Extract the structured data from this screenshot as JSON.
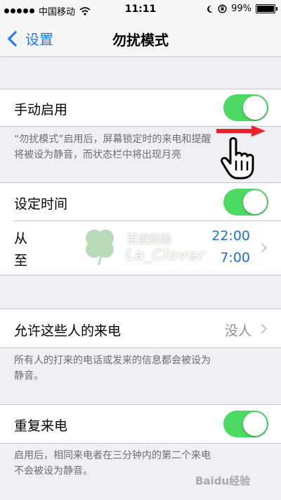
{
  "status_bar": {
    "carrier": "中国移动",
    "time": "11:11",
    "battery": "99%",
    "battery_level": 0.99
  },
  "nav": {
    "back_label": "设置",
    "title": "勿扰模式"
  },
  "manual": {
    "label": "手动启用",
    "on": true,
    "footer_line1": "“勿扰模式”启用后，屏幕锁定时的来电和提醒",
    "footer_line2": "将被设为静音，而状态栏中将出现月亮"
  },
  "scheduled": {
    "label": "设定时间",
    "on": true,
    "from_label": "从",
    "to_label": "至",
    "from_time": "22:00",
    "to_time": "7:00"
  },
  "allow_calls": {
    "label": "允许这些人的来电",
    "value": "没人",
    "footer_line1": "所有人的打来的电话或发来的信息都会被设为",
    "footer_line2": "静音。"
  },
  "repeated": {
    "label": "重复来电",
    "on": true,
    "footer_line1": "启用后，相同来电者在三分钟内的第二个来电",
    "footer_line2": "不会被设为静音。"
  },
  "watermark": {
    "line1": "百度经验",
    "line2": "La_Clover",
    "baidu": "Baidu经验"
  },
  "colors": {
    "accent": "#1a7cf5",
    "switch_on": "#4cd964",
    "time_value": "#1f6fd1",
    "background": "#efeff4"
  }
}
